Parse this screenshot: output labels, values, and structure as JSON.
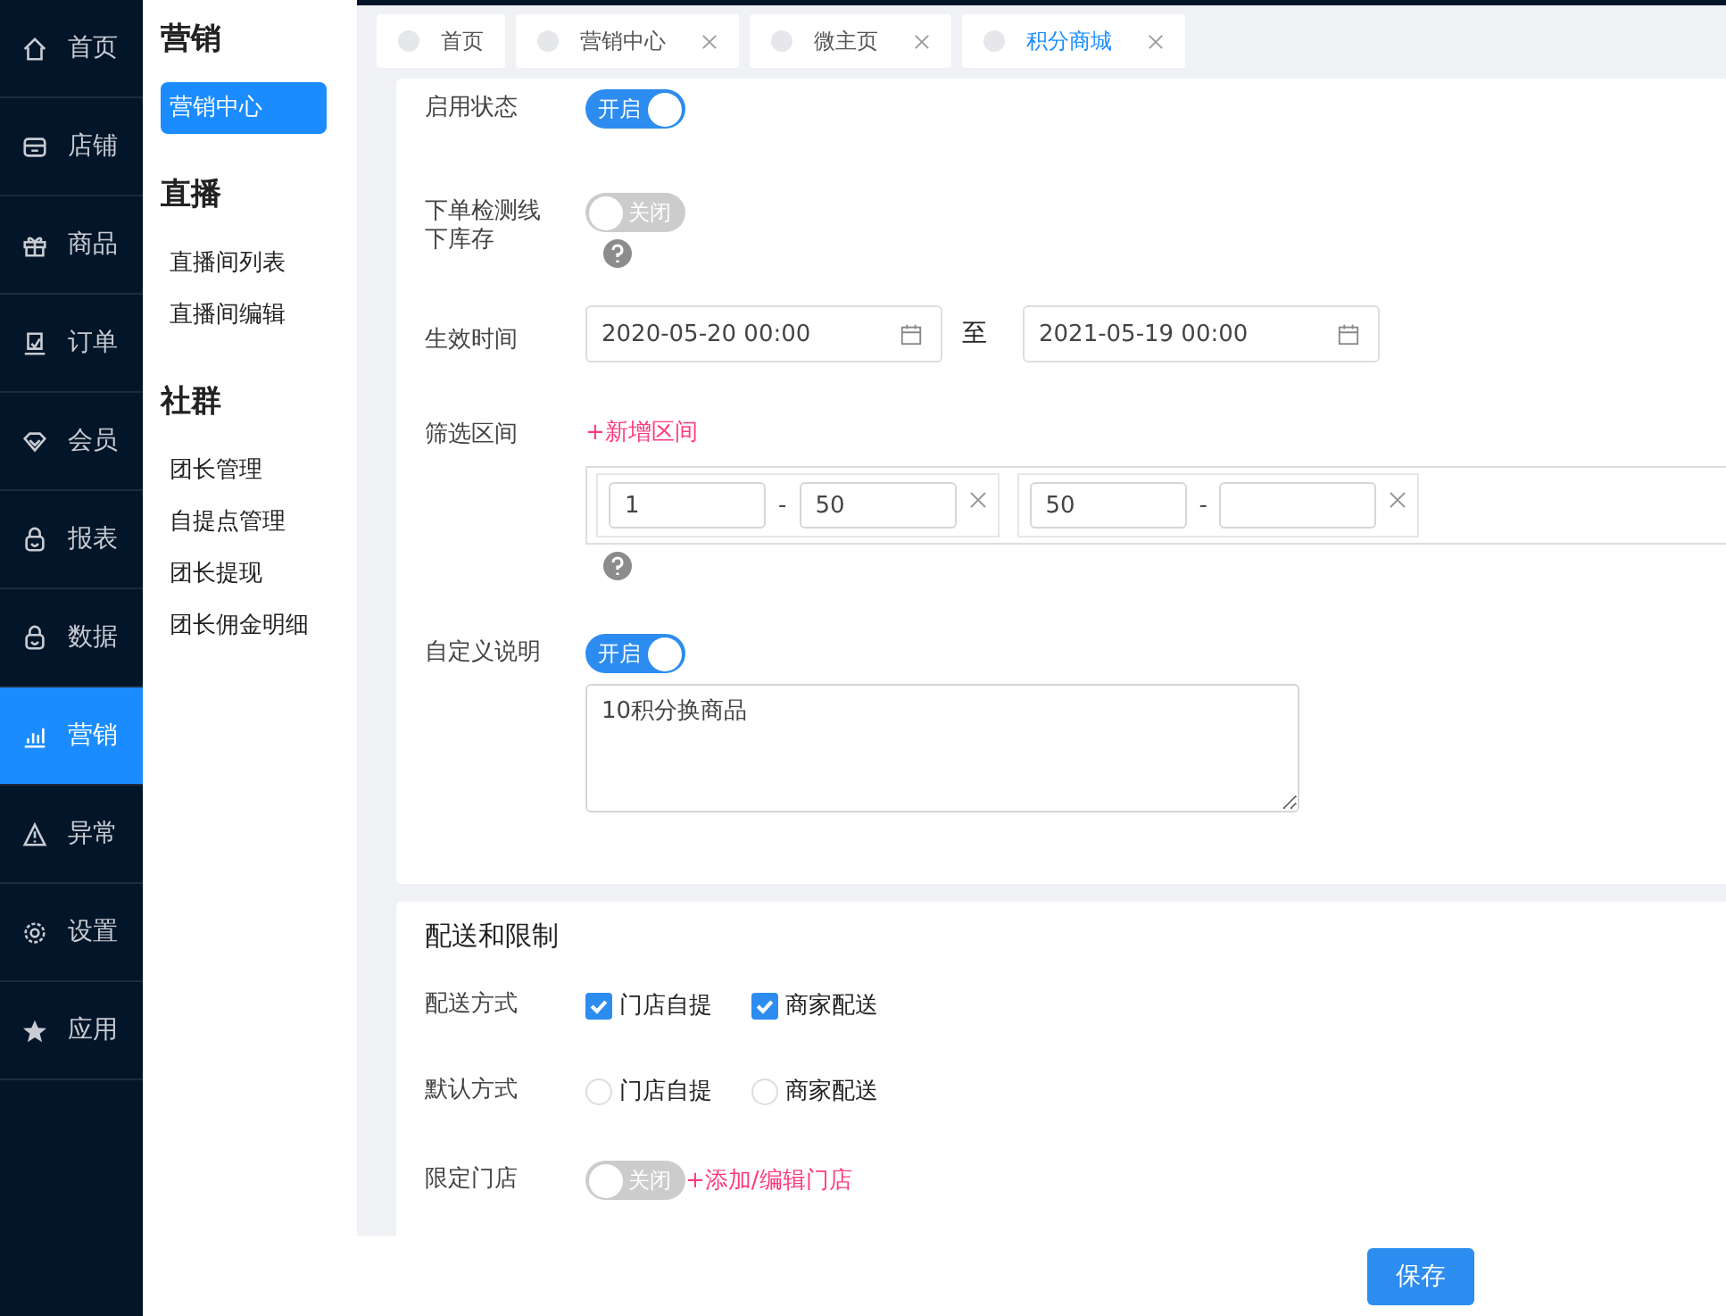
{
  "nav": [
    {
      "label": "首页",
      "selected": false
    },
    {
      "label": "店铺",
      "selected": false
    },
    {
      "label": "商品",
      "selected": false
    },
    {
      "label": "订单",
      "selected": false
    },
    {
      "label": "会员",
      "selected": false
    },
    {
      "label": "报表",
      "selected": false
    },
    {
      "label": "数据",
      "selected": false
    },
    {
      "label": "营销",
      "selected": true
    },
    {
      "label": "异常",
      "selected": false
    },
    {
      "label": "设置",
      "selected": false
    },
    {
      "label": "应用",
      "selected": false
    }
  ],
  "submenu": [
    {
      "title": "营销",
      "items": [
        {
          "label": "营销中心",
          "selected": true
        }
      ]
    },
    {
      "title": "直播",
      "items": [
        {
          "label": "直播间列表",
          "selected": false
        },
        {
          "label": "直播间编辑",
          "selected": false
        }
      ]
    },
    {
      "title": "社群",
      "items": [
        {
          "label": "团长管理",
          "selected": false
        },
        {
          "label": "自提点管理",
          "selected": false
        },
        {
          "label": "团长提现",
          "selected": false
        },
        {
          "label": "团长佣金明细",
          "selected": false
        }
      ]
    }
  ],
  "tabs": [
    {
      "label": "首页",
      "selected": false,
      "closable": false
    },
    {
      "label": "营销中心",
      "selected": false,
      "closable": true
    },
    {
      "label": "微主页",
      "selected": false,
      "closable": true
    },
    {
      "label": "积分商城",
      "selected": true,
      "closable": true
    }
  ],
  "settings": {
    "rows": [
      {
        "kind": "switch",
        "label": "启用状态",
        "on": true,
        "switch_text": "开启"
      },
      {
        "kind": "switch",
        "label": "下单检测线下库存",
        "on": false,
        "switch_text": "关闭",
        "help": true
      },
      {
        "kind": "date_range",
        "label": "生效时间",
        "start": "2020-05-20 00:00",
        "separator": "至",
        "end": "2021-05-19 00:00"
      },
      {
        "kind": "ranges",
        "label": "筛选区间",
        "add_link": "+新增区间",
        "help": true,
        "ranges": [
          {
            "min": "1",
            "dash": "-",
            "max": "50"
          },
          {
            "min": "50",
            "dash": "-"
          }
        ]
      },
      {
        "kind": "switch_text",
        "label": "自定义说明",
        "on": true,
        "switch_text": "开启",
        "text": "10积分换商品"
      }
    ]
  },
  "delivery": {
    "title": "配送和限制",
    "rows": [
      {
        "kind": "checkbox",
        "label": "配送方式",
        "options": [
          {
            "label": "门店自提",
            "checked": true
          },
          {
            "label": "商家配送",
            "checked": true
          }
        ]
      },
      {
        "kind": "radio",
        "label": "默认方式",
        "options": [
          {
            "label": "门店自提",
            "selected": false
          },
          {
            "label": "商家配送",
            "selected": false
          }
        ]
      },
      {
        "kind": "switch",
        "label": "限定门店",
        "on": false,
        "switch_text": "关闭",
        "link": "+添加/编辑门店"
      }
    ]
  },
  "save_button": "保存"
}
